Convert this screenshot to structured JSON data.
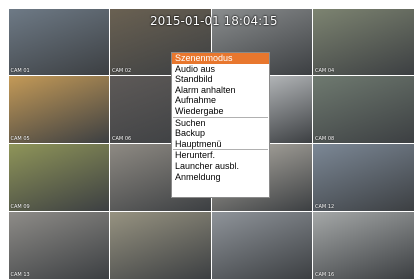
{
  "overlay": {
    "datetime": "2015-01-01 18:04:15"
  },
  "cameras": [
    {
      "label": "CAM 01",
      "color": "#6e7a86"
    },
    {
      "label": "CAM 02",
      "color": "#6a6152"
    },
    {
      "label": "",
      "color": "#8a8d8e"
    },
    {
      "label": "CAM 04",
      "color": "#7d8471"
    },
    {
      "label": "CAM 05",
      "color": "#c49a57"
    },
    {
      "label": "CAM 06",
      "color": "#5e5a58"
    },
    {
      "label": "",
      "color": "#cfd2d4"
    },
    {
      "label": "CAM 08",
      "color": "#6f7a70"
    },
    {
      "label": "CAM 09",
      "color": "#8f9559"
    },
    {
      "label": "",
      "color": "#8e8a83"
    },
    {
      "label": "",
      "color": "#b5b1a8"
    },
    {
      "label": "CAM 12",
      "color": "#7c8896"
    },
    {
      "label": "CAM 13",
      "color": "#8e8c88"
    },
    {
      "label": "",
      "color": "#979381"
    },
    {
      "label": "",
      "color": "#8f949a"
    },
    {
      "label": "CAM 16",
      "color": "#a5a8a8"
    }
  ],
  "menu": {
    "items": [
      {
        "label": "Szenenmodus",
        "selected": true,
        "sep_after": false
      },
      {
        "label": "Audio aus",
        "selected": false,
        "sep_after": false
      },
      {
        "label": "Standbild",
        "selected": false,
        "sep_after": false
      },
      {
        "label": "Alarm anhalten",
        "selected": false,
        "sep_after": false
      },
      {
        "label": "Aufnahme",
        "selected": false,
        "sep_after": false
      },
      {
        "label": "Wiedergabe",
        "selected": false,
        "sep_after": true
      },
      {
        "label": "Suchen",
        "selected": false,
        "sep_after": false
      },
      {
        "label": "Backup",
        "selected": false,
        "sep_after": false
      },
      {
        "label": "Hauptmenü",
        "selected": false,
        "sep_after": true
      },
      {
        "label": "Herunterf.",
        "selected": false,
        "sep_after": false
      },
      {
        "label": "Launcher ausbl.",
        "selected": false,
        "sep_after": false
      },
      {
        "label": "Anmeldung",
        "selected": false,
        "sep_after": false
      }
    ]
  }
}
